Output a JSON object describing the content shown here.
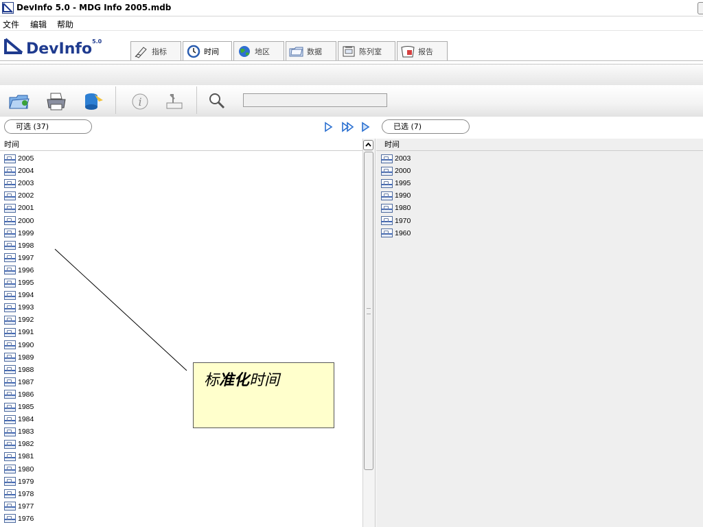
{
  "window": {
    "title": "DevInfo 5.0 - MDG Info 2005.mdb"
  },
  "menu": {
    "items": [
      "文件",
      "编辑",
      "帮助"
    ]
  },
  "logo": {
    "text": "DevInfo",
    "version": "5.0"
  },
  "tabs": [
    {
      "label": "指标",
      "icon": "pen-icon",
      "active": false
    },
    {
      "label": "时间",
      "icon": "clock-icon",
      "active": true
    },
    {
      "label": "地区",
      "icon": "globe-icon",
      "active": false
    },
    {
      "label": "数据",
      "icon": "folder-icon",
      "active": false
    },
    {
      "label": "陈列室",
      "icon": "gallery-icon",
      "active": false
    },
    {
      "label": "报告",
      "icon": "report-icon",
      "active": false
    }
  ],
  "toolbar": {
    "buttons": [
      "open-folder-icon",
      "print-icon",
      "export-database-icon",
      "info-icon",
      "upload-icon",
      "search-icon"
    ],
    "search_value": ""
  },
  "available": {
    "header": "可选 (37)",
    "column": "时间",
    "items": [
      "2005",
      "2004",
      "2003",
      "2002",
      "2001",
      "2000",
      "1999",
      "1998",
      "1997",
      "1996",
      "1995",
      "1994",
      "1993",
      "1992",
      "1991",
      "1990",
      "1989",
      "1988",
      "1987",
      "1986",
      "1985",
      "1984",
      "1983",
      "1982",
      "1981",
      "1980",
      "1979",
      "1978",
      "1977",
      "1976"
    ]
  },
  "selected": {
    "header": "已选 (7)",
    "column": "时间",
    "items": [
      "2003",
      "2000",
      "1995",
      "1990",
      "1980",
      "1970",
      "1960"
    ]
  },
  "transfer_buttons": [
    "move-right-icon",
    "move-all-right-icon",
    "move-right-alt-icon"
  ],
  "callout": {
    "prefix": "标",
    "bold": "准化",
    "suffix": "时间"
  },
  "colors": {
    "accent": "#1f3b8f",
    "callout_bg": "#ffffcc",
    "selected_bg": "#efefef"
  }
}
